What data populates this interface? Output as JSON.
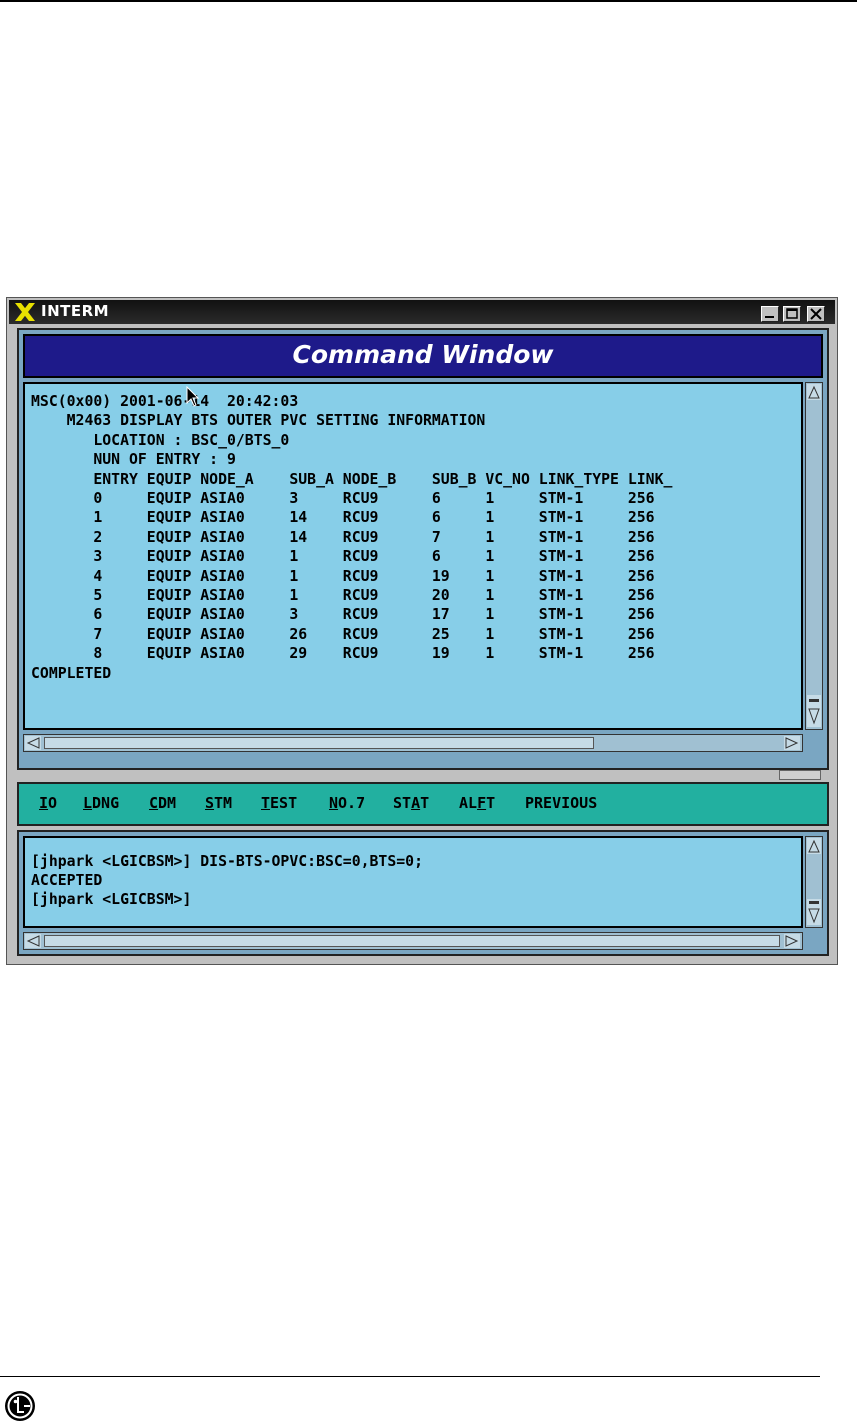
{
  "window": {
    "app_title": "INTERM",
    "header_title": "Command Window"
  },
  "output": {
    "lines": [
      "MSC(0x00) 2001-06-14  20:42:03",
      "    M2463 DISPLAY BTS OUTER PVC SETTING INFORMATION",
      "       LOCATION : BSC_0/BTS_0",
      "       NUN OF ENTRY : 9",
      "       ENTRY EQUIP NODE_A    SUB_A NODE_B    SUB_B VC_NO LINK_TYPE LINK_",
      "       0     EQUIP ASIA0     3     RCU9      6     1     STM-1     256",
      "       1     EQUIP ASIA0     14    RCU9      6     1     STM-1     256",
      "       2     EQUIP ASIA0     14    RCU9      7     1     STM-1     256",
      "       3     EQUIP ASIA0     1     RCU9      6     1     STM-1     256",
      "       4     EQUIP ASIA0     1     RCU9      19    1     STM-1     256",
      "       5     EQUIP ASIA0     1     RCU9      20    1     STM-1     256",
      "       6     EQUIP ASIA0     3     RCU9      17    1     STM-1     256",
      "       7     EQUIP ASIA0     26    RCU9      25    1     STM-1     256",
      "       8     EQUIP ASIA0     29    RCU9      19    1     STM-1     256",
      "COMPLETED"
    ]
  },
  "menu": {
    "items": [
      {
        "pre": "",
        "u": "I",
        "post": "O"
      },
      {
        "pre": "",
        "u": "L",
        "post": "DNG"
      },
      {
        "pre": "",
        "u": "C",
        "post": "DM"
      },
      {
        "pre": "",
        "u": "S",
        "post": "TM"
      },
      {
        "pre": "",
        "u": "T",
        "post": "EST"
      },
      {
        "pre": "",
        "u": "N",
        "post": "O.7"
      },
      {
        "pre": "ST",
        "u": "A",
        "post": "T"
      },
      {
        "pre": "AL",
        "u": "F",
        "post": "T"
      },
      {
        "pre": "PREVIOUS",
        "u": "",
        "post": ""
      }
    ]
  },
  "command": {
    "lines": [
      "[jhpark <LGICBSM>] DIS-BTS-OPVC:BSC=0,BTS=0;",
      "ACCEPTED",
      "[jhpark <LGICBSM>]"
    ]
  },
  "colors": {
    "header_bg": "#1e1a8a",
    "output_bg": "#87cee8",
    "menubar_bg": "#22b0a0"
  }
}
